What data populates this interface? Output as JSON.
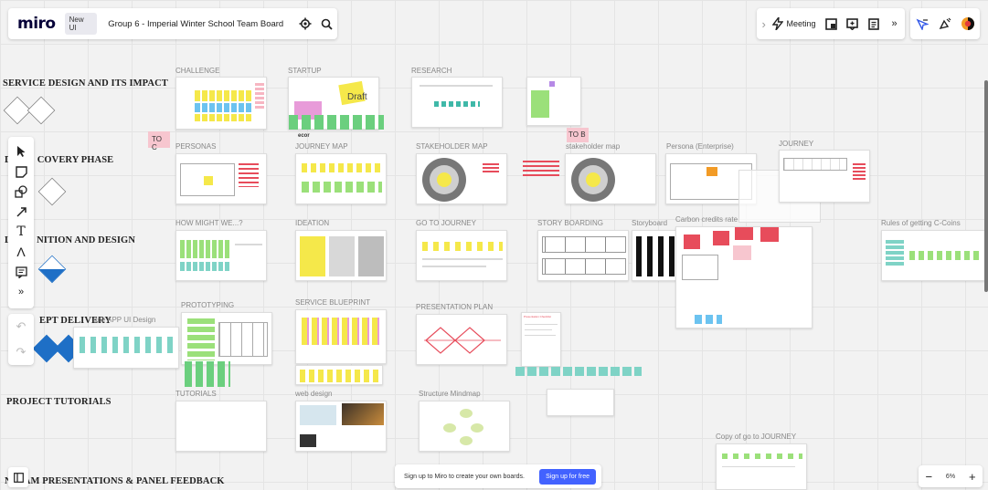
{
  "header": {
    "logo": "miro",
    "new_ui_badge": "New UI",
    "board_name": "Group 6 - Imperial Winter School Team Board",
    "meeting_label": "Meeting"
  },
  "sections": [
    "SERVICE DESIGN AND ITS IMPACT",
    "COVERY PHASE",
    "NITION AND DESIGN",
    "EPT DELIVERY",
    "PROJECT TUTORIALS",
    "EAM PRESENTATIONS & PANEL FEEDBACK"
  ],
  "section_prefixes": [
    "D",
    "L",
    "",
    "N"
  ],
  "frames": {
    "challenge": "CHALLENGE",
    "startup": "STARTUP",
    "research": "RESEARCH",
    "personas": "PERSONAS",
    "journey_map": "JOURNEY MAP",
    "stakeholder_map": "STAKEHOLDER MAP",
    "stakeholder_map_2": "stakeholder map",
    "persona_enterprise": "Persona (Enterprise)",
    "journey": "JOURNEY",
    "how_might_we": "HOW MIGHT WE...?",
    "ideation": "IDEATION",
    "go_to_journey": "GO TO JOURNEY",
    "story_boarding": "STORY BOARDING",
    "storyboard": "Storyboard",
    "carbon_credits": "Carbon credits rate",
    "rules_c_coins": "Rules of getting C-Coins",
    "prototyping": "PROTOTYPING",
    "one_app": "one APP UI Design",
    "service_blueprint": "SERVICE BLUEPRINT",
    "presentation_plan": "PRESENTATION PLAN",
    "presentation_checklist": "Presentation Checklist",
    "tutorials": "TUTORIALS",
    "web_design": "web design",
    "structure_mindmap": "Structure Mindmap",
    "copy_go_to_journey": "Copy of go to JOURNEY"
  },
  "stickers": {
    "draft": "Draft",
    "to_c": "TO C",
    "to_b": "TO B"
  },
  "signup": {
    "text": "Sign up to Miro to create your own boards.",
    "button": "Sign up for free"
  },
  "zoom": {
    "minus": "−",
    "value": "6%",
    "plus": "+"
  },
  "icons": {
    "settings": "⚙",
    "search": "⌕",
    "chevron": "›",
    "bolt": "ϟ",
    "more": "»"
  },
  "colors": {
    "accent": "#4262ff",
    "sticky_yellow": "#f5e84a",
    "sticky_green": "#9be07a",
    "sticky_teal": "#7fd3c6",
    "sticky_pink": "#f7c6cf",
    "diamond_blue": "#1e6fc6",
    "red_note": "#e74c5b"
  }
}
